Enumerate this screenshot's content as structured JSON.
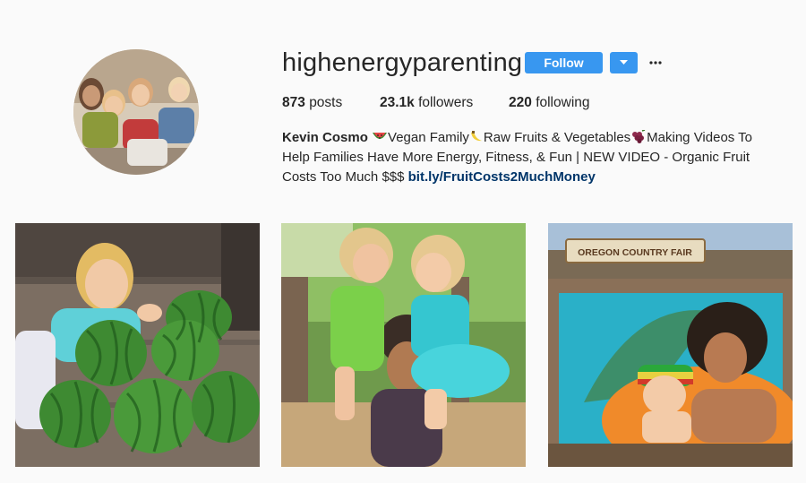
{
  "profile": {
    "username": "highenergyparenting",
    "follow_label": "Follow",
    "dropdown_icon": "chevron-down-icon",
    "more_icon": "ellipsis-icon",
    "stats": {
      "posts_count": "873",
      "posts_label": "posts",
      "followers_count": "23.1k",
      "followers_label": "followers",
      "following_count": "220",
      "following_label": "following"
    },
    "bio": {
      "name": "Kevin Cosmo",
      "text1": "Vegan Family",
      "text2": "Raw Fruits & Vegetables",
      "text3": "Making Videos To Help Families Have More Energy, Fitness, & Fun | NEW VIDEO - Organic Fruit Costs Too Much $$$ ",
      "link": "bit.ly/FruitCosts2MuchMoney"
    },
    "accent_color": "#3897f0",
    "link_color": "#003569"
  },
  "posts": [
    {
      "description_icon": "watermelons-photo"
    },
    {
      "description_icon": "family-photo",
      "sign": ""
    },
    {
      "sign_text": "OREGON COUNTRY FAIR"
    }
  ]
}
